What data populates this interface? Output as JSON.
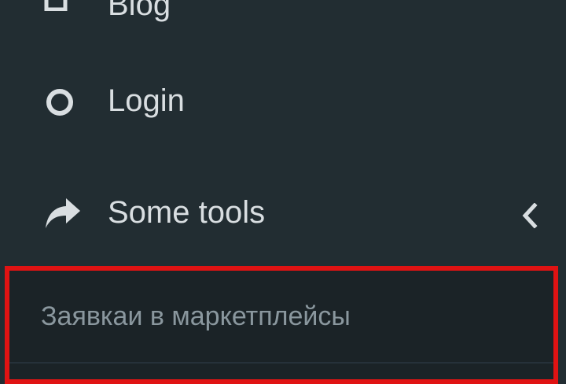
{
  "sidebar": {
    "items": [
      {
        "label": "Blog",
        "icon": "document-icon"
      },
      {
        "label": "Login",
        "icon": "circle-icon"
      },
      {
        "label": "Some tools",
        "icon": "share-arrow-icon",
        "expand_icon": "chevron-left-icon"
      }
    ],
    "submenu": {
      "items": [
        {
          "label": "Заявкаи в маркетплейсы"
        }
      ],
      "highlight_color": "#e01313"
    }
  },
  "colors": {
    "sidebar_bg": "#222d32",
    "submenu_bg": "#1b2327",
    "text": "#d9dee1",
    "submenu_text": "#8a979e"
  }
}
